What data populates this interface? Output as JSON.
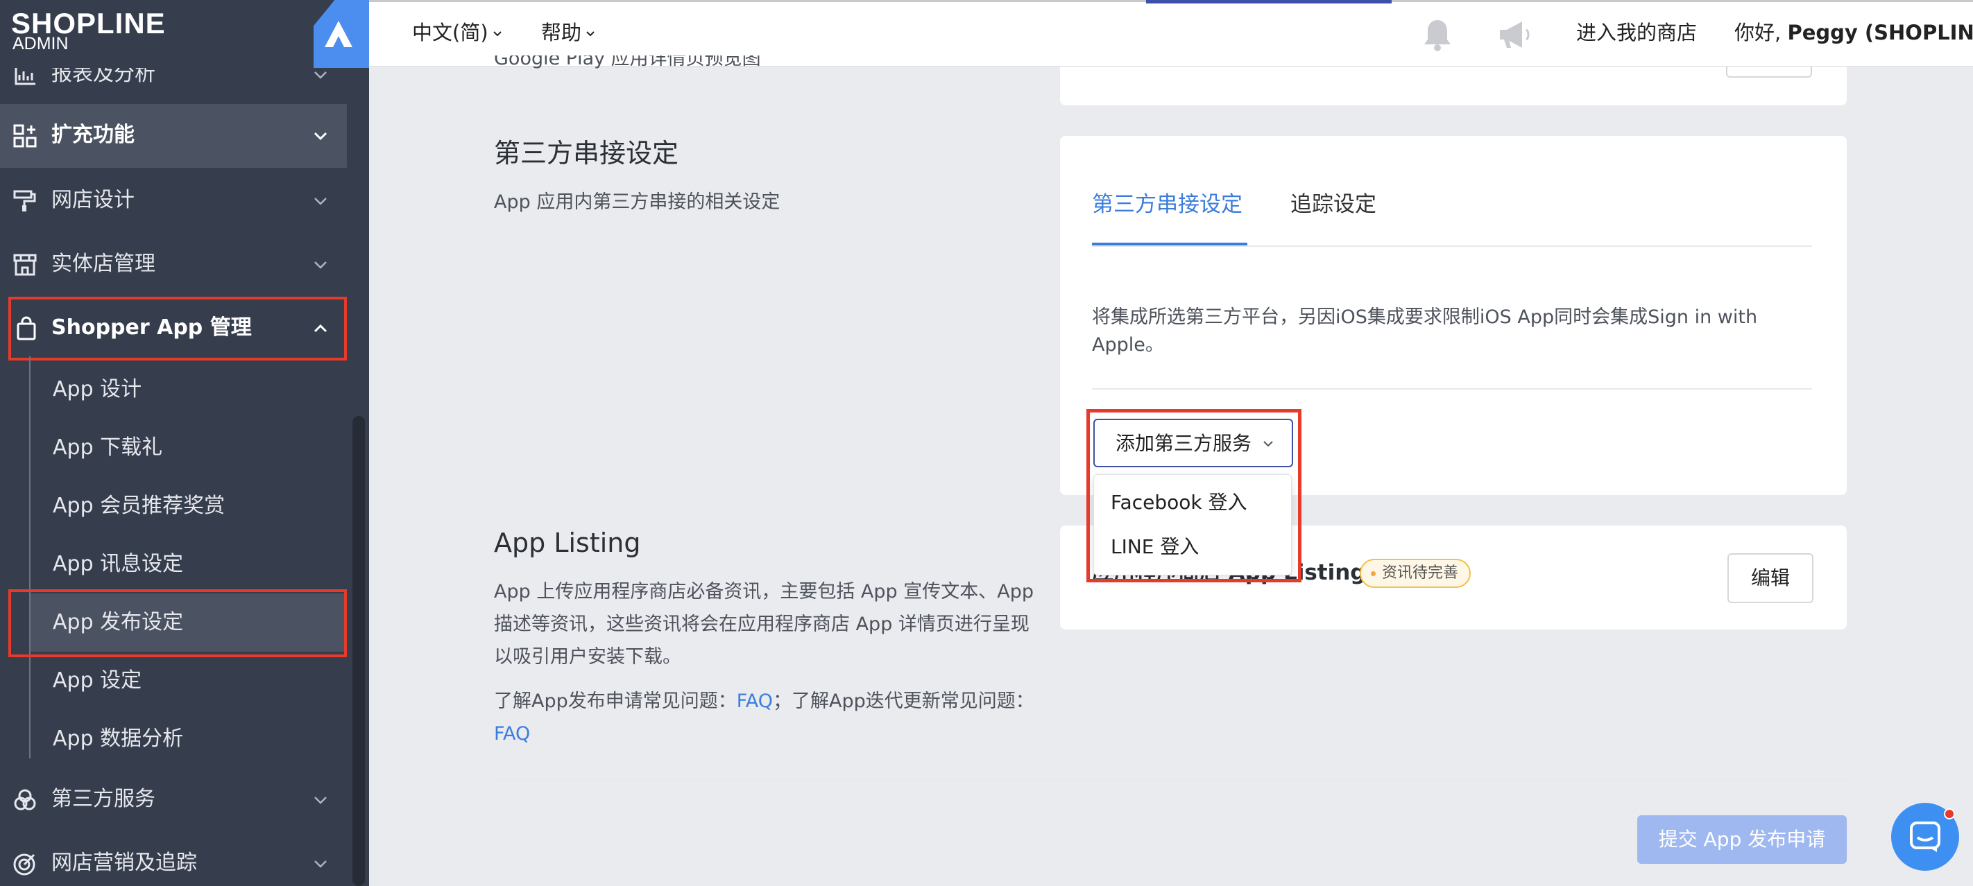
{
  "brand": {
    "logo": "SHOPLINE",
    "sub": "ADMIN"
  },
  "sidebar": {
    "items": [
      {
        "label": "报表及分析"
      },
      {
        "label": "扩充功能"
      },
      {
        "label": "网店设计"
      },
      {
        "label": "实体店管理"
      },
      {
        "label": "Shopper App 管理"
      },
      {
        "label": "第三方服务"
      },
      {
        "label": "网店营销及追踪"
      }
    ],
    "sub_items": [
      {
        "label": "App 设计"
      },
      {
        "label": "App 下载礼"
      },
      {
        "label": "App 会员推荐奖赏"
      },
      {
        "label": "App 讯息设定"
      },
      {
        "label": "App 发布设定"
      },
      {
        "label": "App 设定"
      },
      {
        "label": "App 数据分析"
      }
    ]
  },
  "topbar": {
    "language": "中文(简)",
    "help": "帮助",
    "enter_store": "进入我的商店",
    "greeting_prefix": "你好, ",
    "user": "Peggy (SHOPLINE)"
  },
  "top_card": {
    "partial_text": "Google Play 应用详情页预览图"
  },
  "third_party": {
    "title": "第三方串接设定",
    "desc": "App 应用内第三方串接的相关设定",
    "tabs": [
      {
        "label": "第三方串接设定",
        "active": true
      },
      {
        "label": "追踪设定",
        "active": false
      }
    ],
    "note": "将集成所选第三方平台，另因iOS集成要求限制iOS App同时会集成Sign in with Apple。",
    "add_button": "添加第三方服务",
    "dropdown": [
      "Facebook 登入",
      "LINE 登入"
    ]
  },
  "app_listing": {
    "title": "App Listing",
    "desc": "App 上传应用程序商店必备资讯，主要包括 App 宣传文本、App 描述等资讯，这些资讯将会在应用程序商店 App 详情页进行呈现以吸引用户安装下载。",
    "faq_prefix": "了解App发布申请常见问题：",
    "faq_link": "FAQ",
    "faq_mid": "；了解App迭代更新常见问题：",
    "faq_link2": "FAQ",
    "card_title": "应用程序商店 App Listing",
    "badge": "资讯待完善",
    "edit": "编辑"
  },
  "submit": "提交 App 发布申请",
  "colors": {
    "sidebar": "#363d4c",
    "accent": "#3b7ddd",
    "highlight": "#e63a2b"
  }
}
